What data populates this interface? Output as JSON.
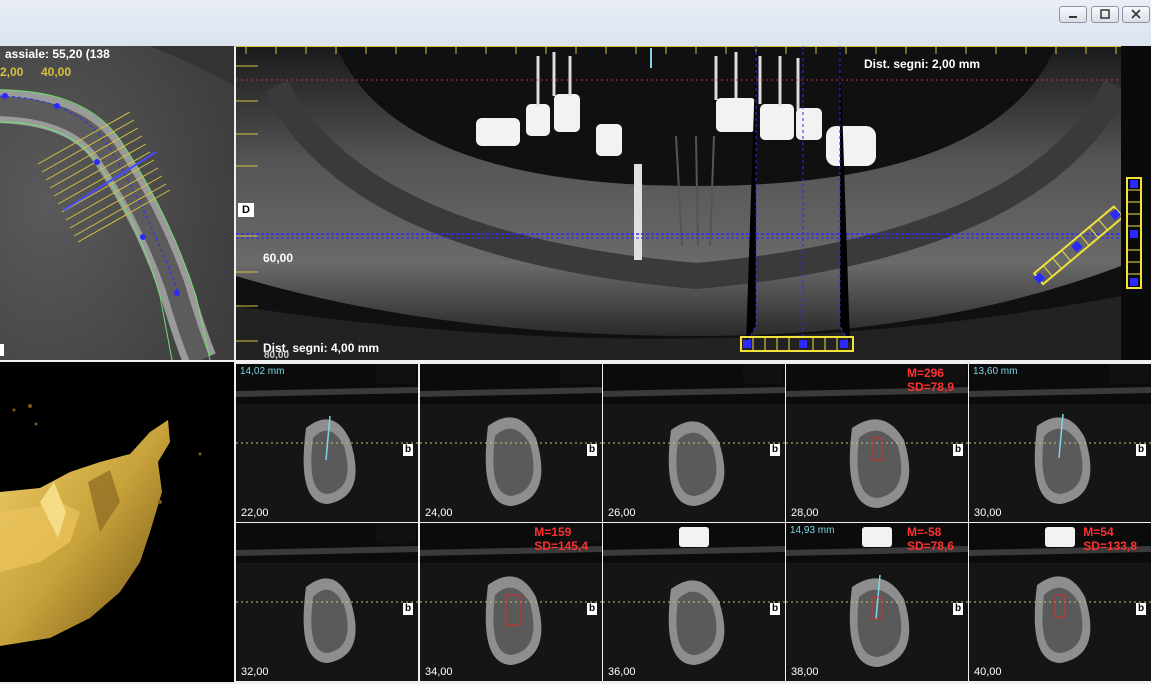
{
  "window": {
    "minimize_label": "minimize",
    "maximize_label": "maximize",
    "close_label": "close"
  },
  "axial_panel": {
    "header": "assiale: 55,20 (138",
    "range_left": "2,00",
    "range_right": "40,00"
  },
  "panoramic": {
    "dist_top": "Dist. segni: 2,00 mm",
    "dist_bottom": "Dist. segni: 4,00 mm",
    "side_marker": "D",
    "depth_label": "60,00",
    "bottom_ruler_label": "80,00"
  },
  "slices": [
    {
      "label": "22,00",
      "measure": "14,02 mm",
      "stat_m": "",
      "stat_sd": "",
      "b": "b"
    },
    {
      "label": "24,00",
      "measure": "",
      "stat_m": "",
      "stat_sd": "",
      "b": "b"
    },
    {
      "label": "26,00",
      "measure": "",
      "stat_m": "",
      "stat_sd": "",
      "b": "b"
    },
    {
      "label": "28,00",
      "measure": "",
      "stat_m": "M=296",
      "stat_sd": "SD=78,9",
      "b": "b"
    },
    {
      "label": "30,00",
      "measure": "13,60 mm",
      "stat_m": "",
      "stat_sd": "",
      "b": "b"
    },
    {
      "label": "32,00",
      "measure": "",
      "stat_m": "",
      "stat_sd": "",
      "b": "b"
    },
    {
      "label": "34,00",
      "measure": "",
      "stat_m": "M=159",
      "stat_sd": "SD=145,4",
      "b": "b"
    },
    {
      "label": "36,00",
      "measure": "",
      "stat_m": "",
      "stat_sd": "",
      "b": "b"
    },
    {
      "label": "38,00",
      "measure": "14,93 mm",
      "stat_m": "M=-58",
      "stat_sd": "SD=78,6",
      "b": "b"
    },
    {
      "label": "40,00",
      "measure": "",
      "stat_m": "M=54",
      "stat_sd": "SD=133,8",
      "b": "b"
    }
  ],
  "colors": {
    "ruler": "#d6c23c",
    "guide": "#2a2aff",
    "measure": "#7fd6e8",
    "stat": "#ff3030",
    "bone_3d": "#c8a23a"
  }
}
